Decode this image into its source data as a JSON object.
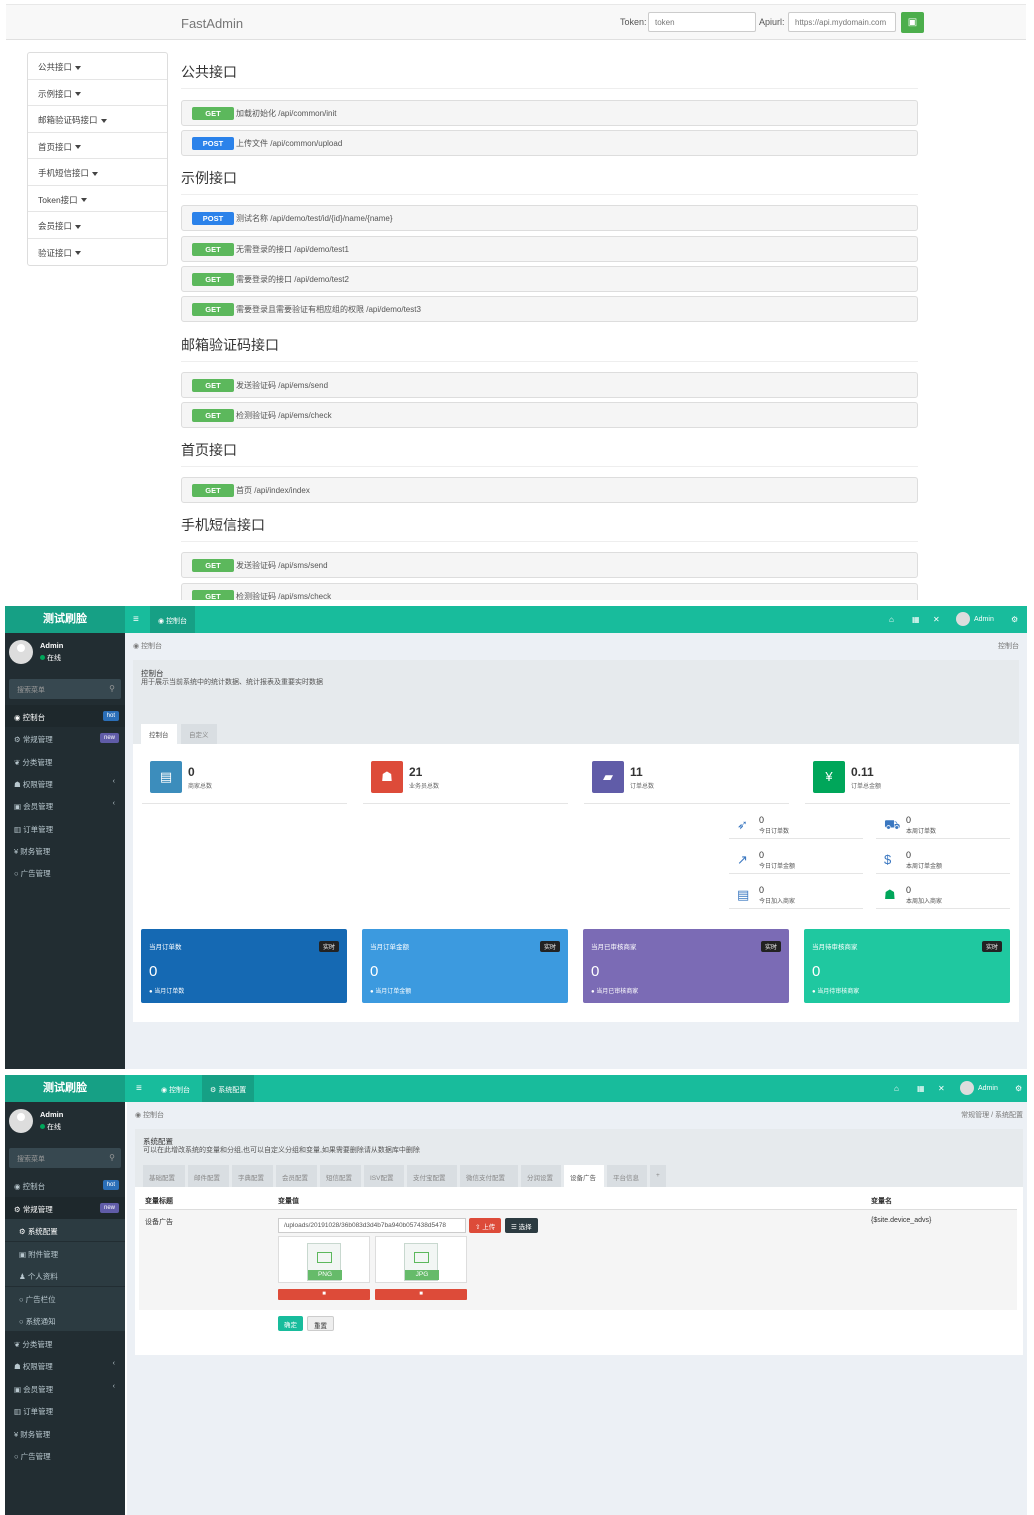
{
  "api": {
    "brand": "FastAdmin",
    "token_label": "Token:",
    "token_placeholder": "token",
    "apiurl_label": "Apiurl:",
    "apiurl_value": "https://api.mydomain.com",
    "save_icon": "save-icon",
    "nav": [
      "公共接口",
      "示例接口",
      "邮箱验证码接口",
      "首页接口",
      "手机短信接口",
      "Token接口",
      "会员接口",
      "验证接口"
    ],
    "groups": [
      {
        "title": "公共接口",
        "endpoints": [
          {
            "method": "GET",
            "text": "加载初始化 /api/common/init"
          },
          {
            "method": "POST",
            "text": "上传文件 /api/common/upload"
          }
        ]
      },
      {
        "title": "示例接口",
        "endpoints": [
          {
            "method": "POST",
            "text": "测试名称 /api/demo/test/id/{id}/name/{name}"
          },
          {
            "method": "GET",
            "text": "无需登录的接口 /api/demo/test1"
          },
          {
            "method": "GET",
            "text": "需要登录的接口 /api/demo/test2"
          },
          {
            "method": "GET",
            "text": "需要登录且需要验证有相应组的权限 /api/demo/test3"
          }
        ]
      },
      {
        "title": "邮箱验证码接口",
        "endpoints": [
          {
            "method": "GET",
            "text": "发送验证码 /api/ems/send"
          },
          {
            "method": "GET",
            "text": "检测验证码 /api/ems/check"
          }
        ]
      },
      {
        "title": "首页接口",
        "endpoints": [
          {
            "method": "GET",
            "text": "首页 /api/index/index"
          }
        ]
      },
      {
        "title": "手机短信接口",
        "endpoints": [
          {
            "method": "GET",
            "text": "发送验证码 /api/sms/send"
          },
          {
            "method": "GET",
            "text": "检测验证码 /api/sms/check"
          }
        ]
      }
    ]
  },
  "dash": {
    "logo": "测试刷脸",
    "user": "Admin",
    "status": "在线",
    "search_placeholder": "搜索菜单",
    "menu": [
      {
        "label": "控制台",
        "icon": "dashboard-icon",
        "badge": "hot"
      },
      {
        "label": "常规管理",
        "icon": "cogs-icon",
        "badge": "new"
      },
      {
        "label": "分类管理",
        "icon": "leaf-icon"
      },
      {
        "label": "权限管理",
        "icon": "group-icon",
        "arrow": "‹"
      },
      {
        "label": "会员管理",
        "icon": "user-icon",
        "arrow": "‹"
      },
      {
        "label": "订单管理",
        "icon": "chart-icon"
      },
      {
        "label": "财务管理",
        "icon": "yen-icon"
      },
      {
        "label": "广告管理",
        "icon": "circle-icon"
      }
    ],
    "top_tab": "控制台",
    "header_user": "Admin",
    "crumb_left": "控制台",
    "crumb_right": "控制台",
    "box_title": "控制台",
    "box_sub": "用于展示当前系统中的统计数据、统计报表及重要实时数据",
    "tabs": [
      "控制台",
      "自定义"
    ],
    "stats": [
      {
        "num": "0",
        "label": "商家总数",
        "color": "#3c8dbc",
        "icon": "bag-icon"
      },
      {
        "num": "21",
        "label": "业务员总数",
        "color": "#dd4b39",
        "icon": "users-icon"
      },
      {
        "num": "11",
        "label": "订单总数",
        "color": "#605ca8",
        "icon": "book-icon"
      },
      {
        "num": "0.11",
        "label": "订单总金额",
        "color": "#00a65a",
        "icon": "yen-icon"
      }
    ],
    "mini": [
      {
        "num": "0",
        "label": "今日订单数",
        "icon": "rocket-icon"
      },
      {
        "num": "0",
        "label": "本周订单数",
        "icon": "cart-icon"
      },
      {
        "num": "0",
        "label": "今日订单金额",
        "icon": "area-chart-icon"
      },
      {
        "num": "0",
        "label": "本周订单金额",
        "icon": "dollar-icon"
      },
      {
        "num": "0",
        "label": "今日加入商家",
        "icon": "list-icon"
      },
      {
        "num": "0",
        "label": "本周加入商家",
        "icon": "users-icon"
      }
    ],
    "cards": [
      {
        "title": "当月订单数",
        "badge": "实时",
        "num": "0",
        "foot": "当月订单数",
        "color": "#1569b3"
      },
      {
        "title": "当月订单金额",
        "badge": "实时",
        "num": "0",
        "foot": "当月订单金额",
        "color": "#3c9adf"
      },
      {
        "title": "当月已审核商家",
        "badge": "实时",
        "num": "0",
        "foot": "当月已审核商家",
        "color": "#7b6bb5"
      },
      {
        "title": "当月待审核商家",
        "badge": "实时",
        "num": "0",
        "foot": "当月待审核商家",
        "color": "#1fc8a0"
      }
    ]
  },
  "cfg": {
    "logo": "测试刷脸",
    "user": "Admin",
    "status": "在线",
    "search_placeholder": "搜索菜单",
    "menu": [
      {
        "label": "控制台",
        "badge": "hot",
        "type": "top"
      },
      {
        "label": "常规管理",
        "badge": "new",
        "type": "top"
      },
      {
        "label": "系统配置",
        "type": "sub-active"
      },
      {
        "label": "附件管理",
        "type": "sub"
      },
      {
        "label": "个人资料",
        "type": "sub"
      },
      {
        "label": "广告栏位",
        "type": "sub"
      },
      {
        "label": "系统通知",
        "type": "sub"
      },
      {
        "label": "分类管理",
        "type": "top"
      },
      {
        "label": "权限管理",
        "type": "top",
        "arrow": "‹"
      },
      {
        "label": "会员管理",
        "type": "top",
        "arrow": "‹"
      },
      {
        "label": "订单管理",
        "type": "top"
      },
      {
        "label": "财务管理",
        "type": "top"
      },
      {
        "label": "广告管理",
        "type": "top"
      }
    ],
    "top_tabs": [
      "控制台",
      "系统配置"
    ],
    "header_user": "Admin",
    "crumb_left": "控制台",
    "crumb_right": "常规管理 / 系统配置",
    "box_title": "系统配置",
    "box_sub": "可以在此增改系统的变量和分组,也可以自定义分组和变量,如果需要删除请从数据库中删除",
    "tabs": [
      "基础配置",
      "邮件配置",
      "字典配置",
      "会员配置",
      "短信配置",
      "ISV配置",
      "支付宝配置",
      "微信支付配置",
      "分润设置",
      "设备广告",
      "平台信息",
      "+"
    ],
    "th_title": "变量标题",
    "th_value": "变量值",
    "th_name": "变量名",
    "row_title": "设备广告",
    "row_value": "/uploads/20191028/36b083d3d4b7ba940b057438d5478",
    "upload_btn": "上传",
    "choose_btn": "选择",
    "row_name": "{$site.device_advs}",
    "files": [
      "PNG",
      "JPG"
    ],
    "submit": "确定",
    "reset": "重置"
  }
}
